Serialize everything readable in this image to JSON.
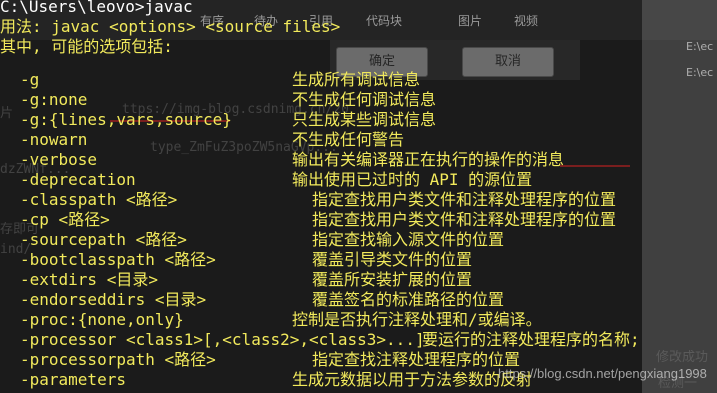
{
  "background": {
    "toolbar_items": [
      "有序",
      "待办",
      "引用",
      "代码块",
      "图片",
      "视频"
    ],
    "confirm_button": "确定",
    "cancel_button": "取消",
    "right_paths": [
      "E:\\ec",
      "E:\\ec"
    ],
    "ghost_lines": [
      "片",
      "ttps://img-blog.csdnimg.cn/20",
      "type_ZmFuZ3poZW5naGVp...",
      "dzZWNf...",
      "存即可",
      "ind/",
      "修改成功",
      "检测一"
    ]
  },
  "watermark": "https://blog.csdn.net/pengxiang1998",
  "console": {
    "prompt": "C:\\Users\\leovo>javac",
    "usage": "用法: javac <options> <source files>",
    "where": "其中, 可能的选项包括:",
    "options": [
      {
        "opt": "-g",
        "desc": "生成所有调试信息"
      },
      {
        "opt": "-g:none",
        "desc": "不生成任何调试信息"
      },
      {
        "opt": "-g:{lines,vars,source}",
        "desc": "只生成某些调试信息"
      },
      {
        "opt": "-nowarn",
        "desc": "不生成任何警告"
      },
      {
        "opt": "-verbose",
        "desc": "输出有关编译器正在执行的操作的消息"
      },
      {
        "opt": "-deprecation",
        "desc": "输出使用已过时的 API 的源位置"
      },
      {
        "opt": "-classpath <路径>",
        "desc": "指定查找用户类文件和注释处理程序的位置"
      },
      {
        "opt": "-cp <路径>",
        "desc": "指定查找用户类文件和注释处理程序的位置"
      },
      {
        "opt": "-sourcepath <路径>",
        "desc": "指定查找输入源文件的位置"
      },
      {
        "opt": "-bootclasspath <路径>",
        "desc": "覆盖引导类文件的位置"
      },
      {
        "opt": "-extdirs <目录>",
        "desc": "覆盖所安装扩展的位置"
      },
      {
        "opt": "-endorseddirs <目录>",
        "desc": "覆盖签名的标准路径的位置"
      },
      {
        "opt": "-proc:{none,only}",
        "desc": "控制是否执行注释处理和/或编译。"
      },
      {
        "opt": "-processor <class1>[,<class2>,<class3>...]",
        "desc": "要运行的注释处理程序的名称;"
      },
      {
        "opt": "-processorpath <路径>",
        "desc": "指定查找注释处理程序的位置"
      },
      {
        "opt": "-parameters",
        "desc": "生成元数据以用于方法参数的反射"
      }
    ]
  }
}
